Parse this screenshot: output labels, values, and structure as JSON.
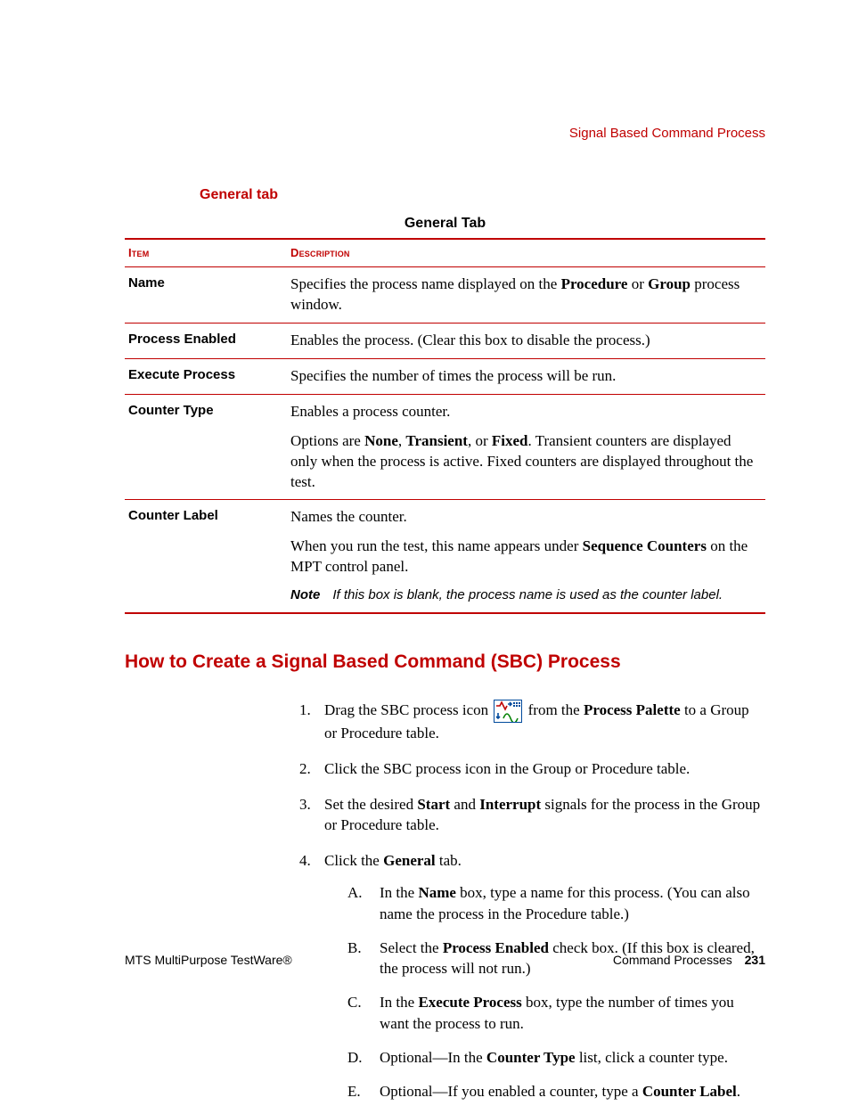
{
  "header": {
    "running": "Signal Based Command Process"
  },
  "sidebarHeading": "General tab",
  "table": {
    "caption": "General Tab",
    "columns": {
      "item": "Item",
      "description": "Description"
    },
    "rows": {
      "name": {
        "item": "Name",
        "p1_a": "Specifies the process name displayed on the ",
        "p1_b": "Procedure",
        "p1_c": " or ",
        "p1_d": "Group",
        "p1_e": " process window."
      },
      "processEnabled": {
        "item": "Process Enabled",
        "p1": "Enables the process. (Clear this box to disable the process.)"
      },
      "executeProcess": {
        "item": "Execute Process",
        "p1": "Specifies the number of times the process will be run."
      },
      "counterType": {
        "item": "Counter Type",
        "p1": "Enables a process counter.",
        "p2_a": "Options are ",
        "p2_b": "None",
        "p2_c": ", ",
        "p2_d": "Transient",
        "p2_e": ", or ",
        "p2_f": "Fixed",
        "p2_g": ". Transient counters are displayed only when the process is active. Fixed counters are displayed throughout the test."
      },
      "counterLabel": {
        "item": "Counter Label",
        "p1": "Names the counter.",
        "p2_a": "When you run the test, this name appears under ",
        "p2_b": "Sequence Counters",
        "p2_c": " on the MPT control panel.",
        "noteLabel": "Note",
        "noteText": "If this box is blank, the process name is used as the counter label."
      }
    }
  },
  "section": {
    "heading": "How to Create a Signal Based Command (SBC) Process",
    "steps": {
      "s1": {
        "num": "1.",
        "a": "Drag the SBC process icon ",
        "b": " from the ",
        "c": "Process Palette",
        "d": " to a Group or Procedure table."
      },
      "s2": {
        "num": "2.",
        "text": "Click the SBC process icon in the Group or Procedure table."
      },
      "s3": {
        "num": "3.",
        "a": "Set the desired ",
        "b": "Start",
        "c": " and ",
        "d": "Interrupt",
        "e": " signals for the process in the Group or Procedure table."
      },
      "s4": {
        "num": "4.",
        "a": "Click the ",
        "b": "General",
        "c": " tab.",
        "sub": {
          "A": {
            "letter": "A.",
            "a": "In the ",
            "b": "Name",
            "c": " box, type a name for this process. (You can also name the process in the Procedure table.)"
          },
          "B": {
            "letter": "B.",
            "a": "Select the ",
            "b": "Process Enabled",
            "c": " check box. (If this box is cleared, the process will not run.)"
          },
          "C": {
            "letter": "C.",
            "a": "In the ",
            "b": "Execute Process",
            "c": " box, type the number of times you want the process to run."
          },
          "D": {
            "letter": "D.",
            "a": "Optional—In the ",
            "b": "Counter Type",
            "c": " list, click a counter type."
          },
          "E": {
            "letter": "E.",
            "a": "Optional—If you enabled a counter, type a ",
            "b": "Counter Label",
            "c": "."
          }
        }
      }
    }
  },
  "footer": {
    "left": "MTS MultiPurpose TestWare®",
    "rightLabel": "Command Processes",
    "pageNum": "231"
  }
}
